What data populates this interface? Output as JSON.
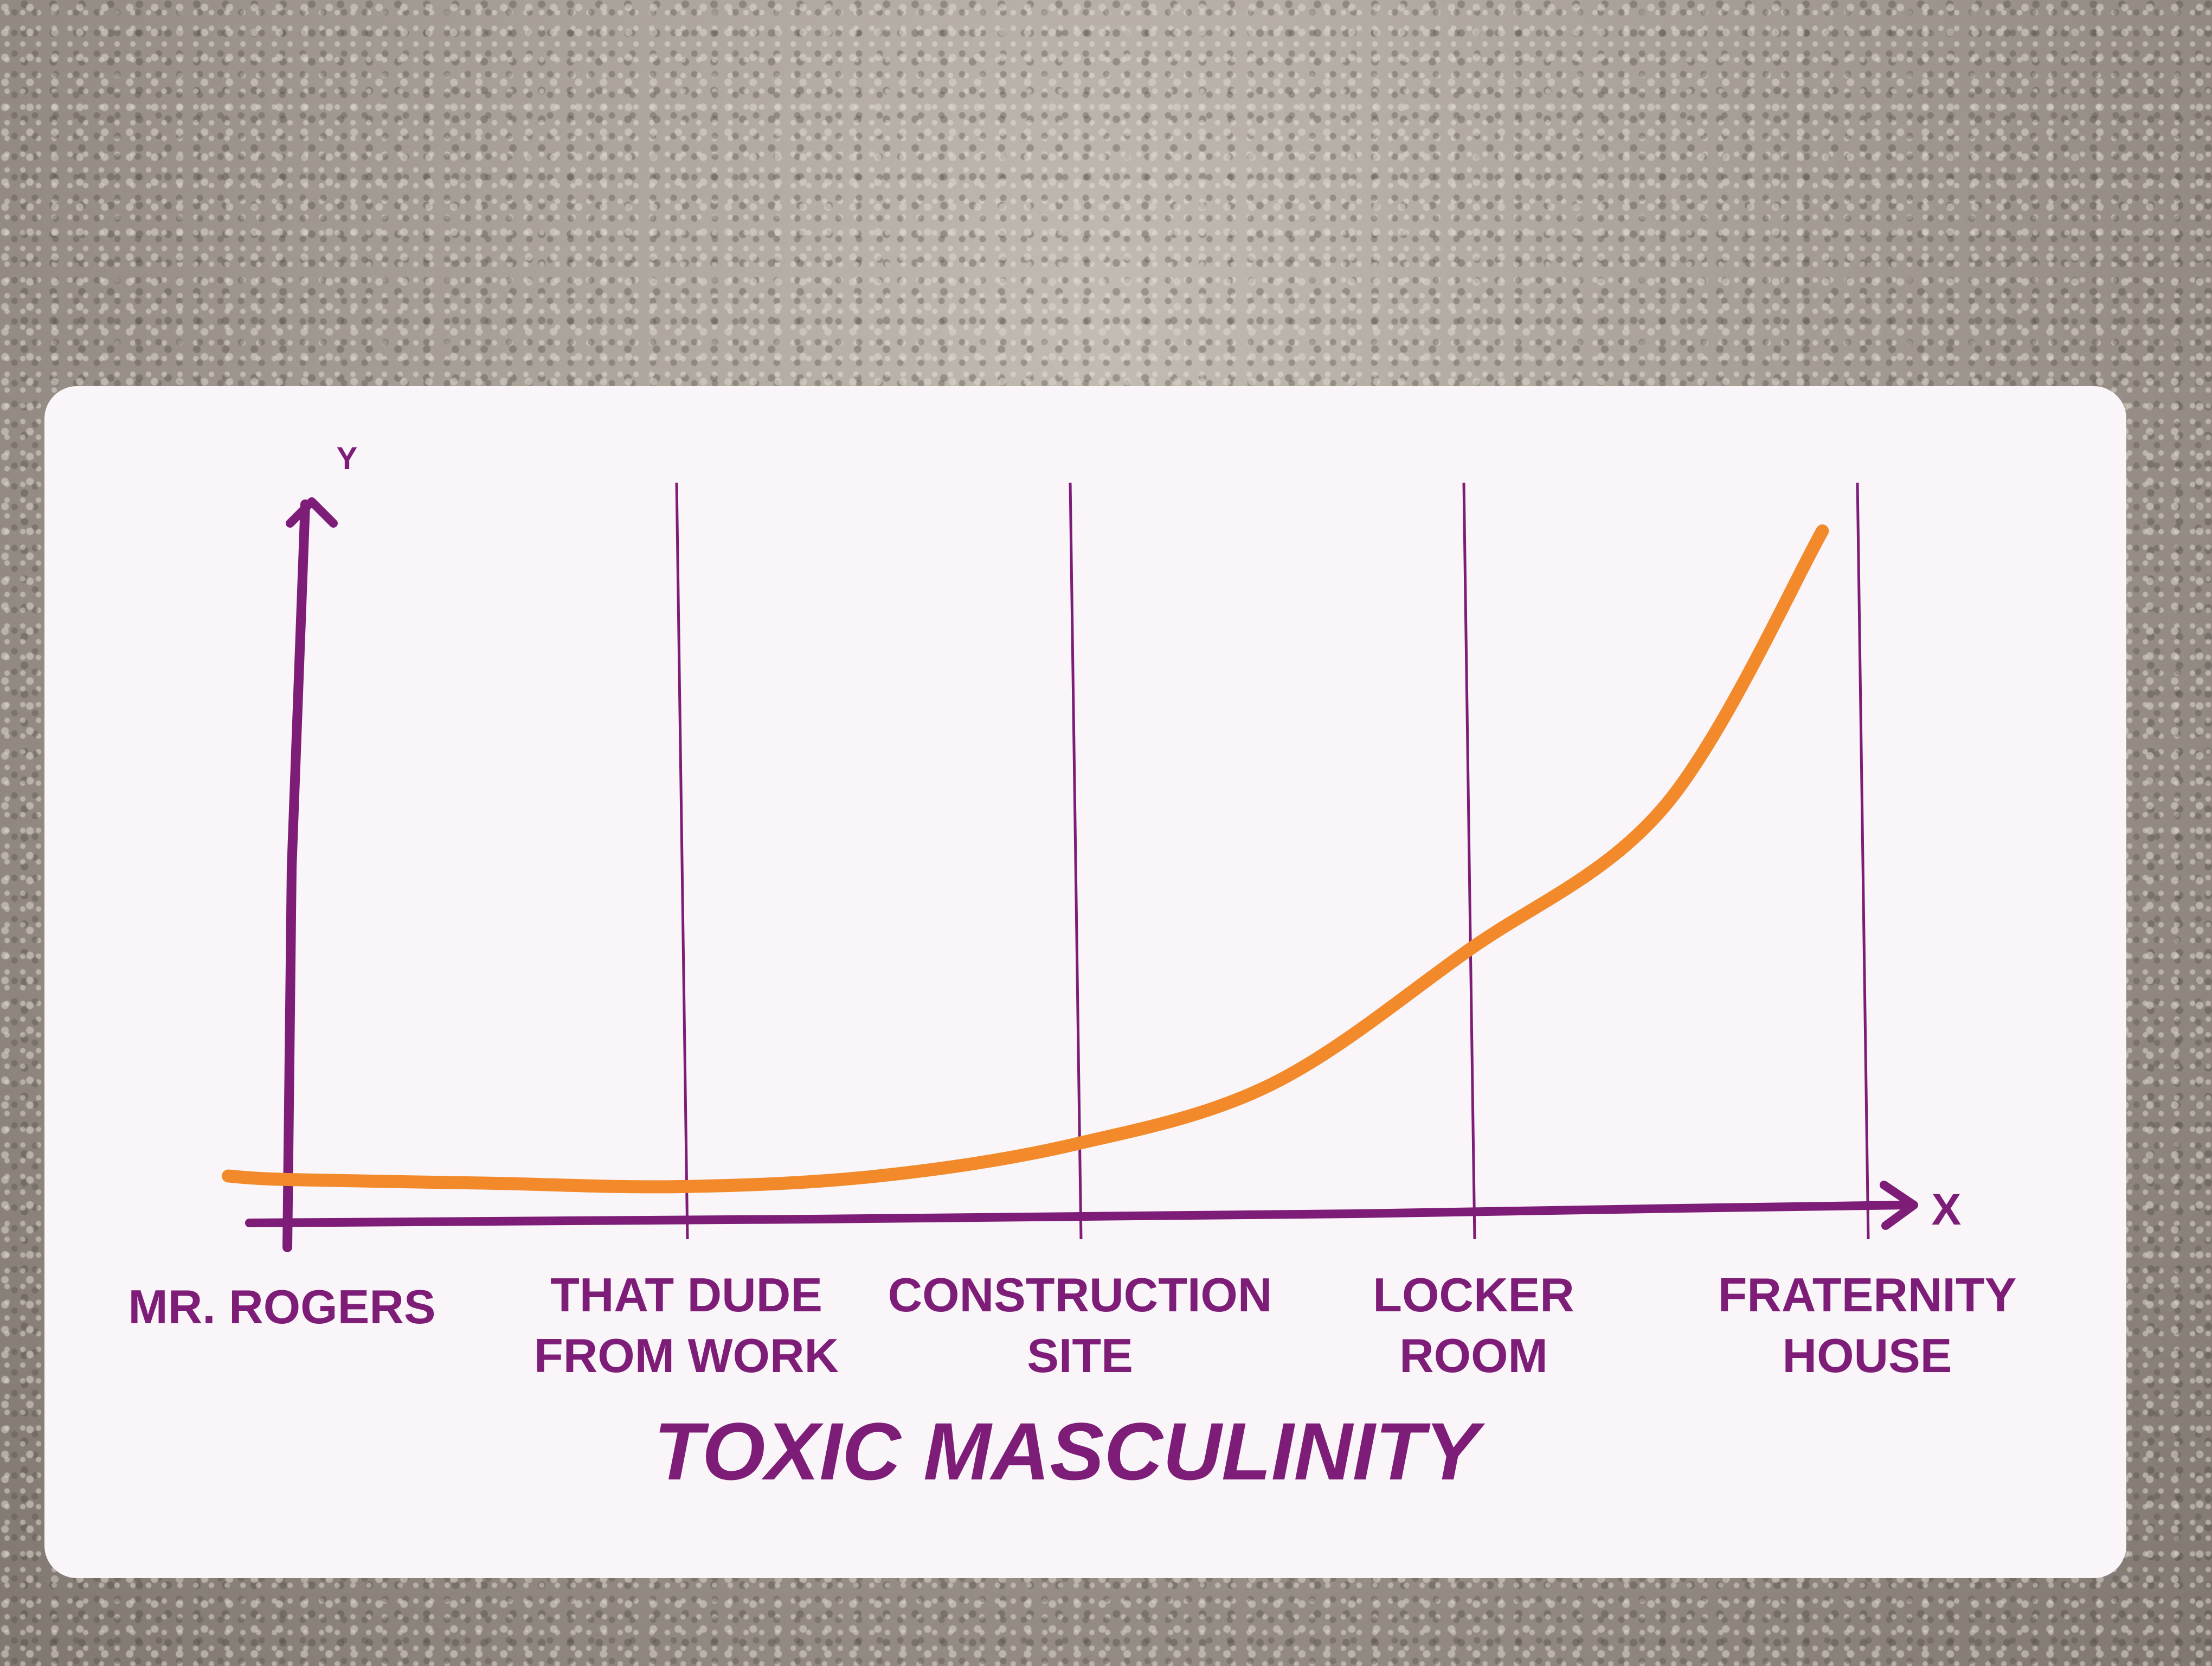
{
  "chart_data": {
    "type": "line",
    "categories": [
      "MR. ROGERS",
      "THAT DUDE\nFROM WORK",
      "CONSTRUCTION\nSITE",
      "LOCKER\nROOM",
      "FRATERNITY\nHOUSE"
    ],
    "x_axis_letter": "X",
    "y_axis_letter": "Y",
    "xlabel": "TOXIC MASCULINITY",
    "ylim": [
      0,
      100
    ],
    "grid": true,
    "series": [
      {
        "x": [
          -0.15,
          0,
          0.5,
          1,
          1.5,
          2,
          2.5,
          3,
          3.5,
          3.9
        ],
        "values": [
          5.5,
          5,
          4.5,
          4,
          5.5,
          10,
          18.5,
          37.5,
          58,
          97
        ]
      }
    ],
    "colors": {
      "axes": "#7e1d78",
      "curve": "#f28a2c",
      "card": "#f9f5f8"
    }
  }
}
